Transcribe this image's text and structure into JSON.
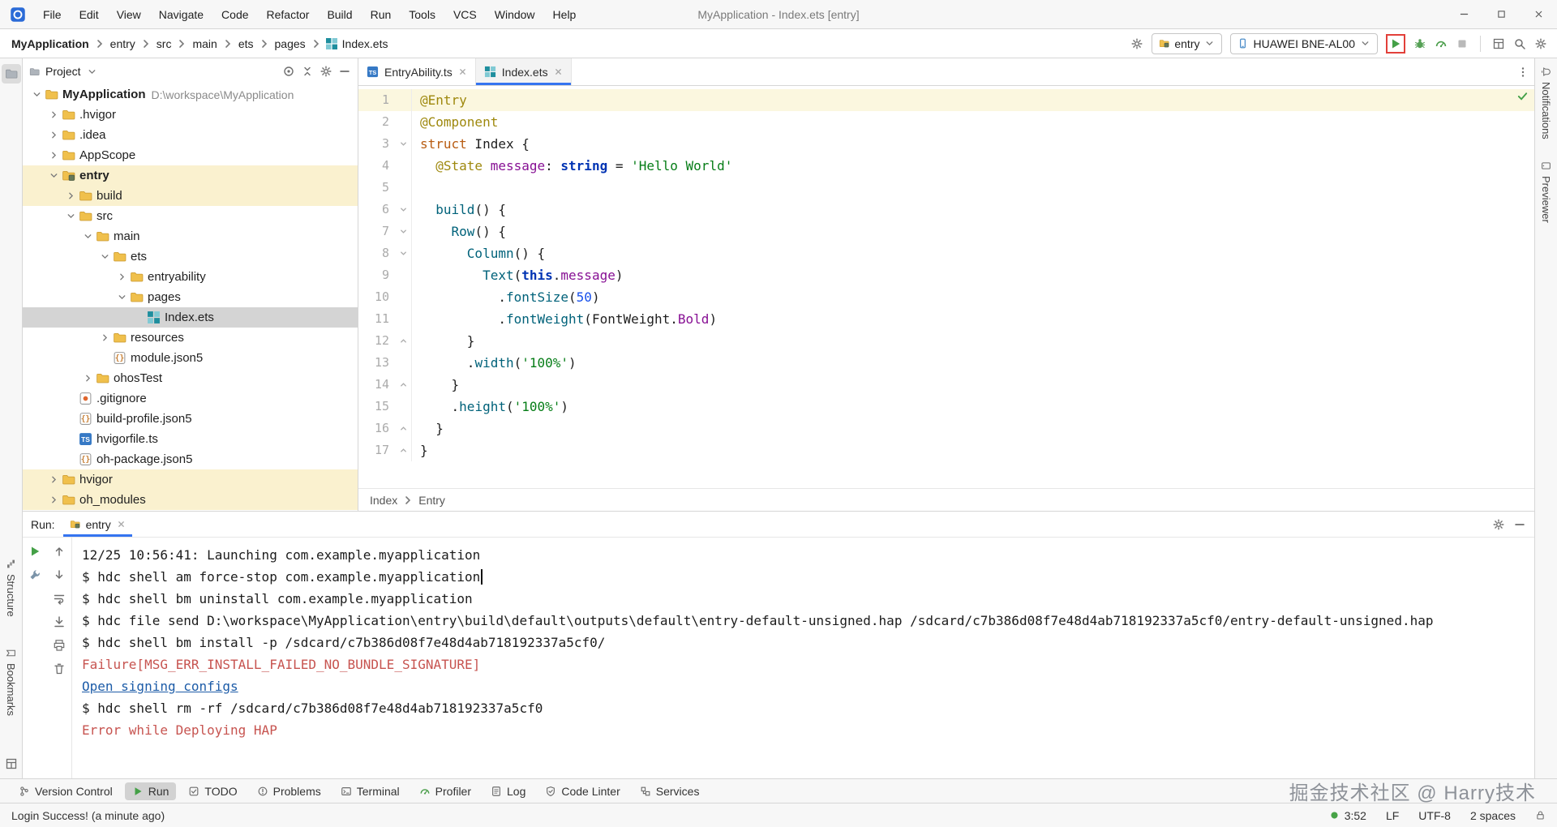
{
  "colors": {
    "accent": "#3574F0",
    "selection": "#D4D4D4",
    "module_row": "#FAF1CF",
    "error": "#C75450",
    "link": "#1D5CA8",
    "run_green": "#44A047",
    "highlight_box": "#E2403A"
  },
  "title_bar": {
    "menus": [
      "File",
      "Edit",
      "View",
      "Navigate",
      "Code",
      "Refactor",
      "Build",
      "Run",
      "Tools",
      "VCS",
      "Window",
      "Help"
    ],
    "title": "MyApplication - Index.ets [entry]"
  },
  "toolbar": {
    "breadcrumbs": [
      "MyApplication",
      "entry",
      "src",
      "main",
      "ets",
      "pages",
      "Index.ets"
    ],
    "run_config": "entry",
    "device": "HUAWEI BNE-AL00"
  },
  "left_stripe": {
    "project": "Project",
    "structure": "Structure",
    "bookmarks": "Bookmarks"
  },
  "right_stripe": {
    "notifications": "Notifications",
    "previewer": "Previewer"
  },
  "project_panel": {
    "header": "Project",
    "tree": [
      {
        "level": 0,
        "arrow": "down",
        "icon": "folder",
        "label": "MyApplication",
        "extra": "D:\\workspace\\MyApplication",
        "bold": true
      },
      {
        "level": 1,
        "arrow": "right",
        "icon": "folder",
        "label": ".hvigor"
      },
      {
        "level": 1,
        "arrow": "right",
        "icon": "folder",
        "label": ".idea"
      },
      {
        "level": 1,
        "arrow": "right",
        "icon": "folder",
        "label": "AppScope"
      },
      {
        "level": 1,
        "arrow": "down",
        "icon": "module",
        "label": "entry",
        "bg": "yellow",
        "bold": true
      },
      {
        "level": 2,
        "arrow": "right",
        "icon": "folder",
        "label": "build",
        "bg": "yellow"
      },
      {
        "level": 2,
        "arrow": "down",
        "icon": "folder",
        "label": "src"
      },
      {
        "level": 3,
        "arrow": "down",
        "icon": "folder",
        "label": "main"
      },
      {
        "level": 4,
        "arrow": "down",
        "icon": "folder",
        "label": "ets"
      },
      {
        "level": 5,
        "arrow": "right",
        "icon": "folder",
        "label": "entryability"
      },
      {
        "level": 5,
        "arrow": "down",
        "icon": "folder",
        "label": "pages"
      },
      {
        "level": 6,
        "arrow": "none",
        "icon": "fileEts",
        "label": "Index.ets",
        "selected": true
      },
      {
        "level": 4,
        "arrow": "right",
        "icon": "folder",
        "label": "resources"
      },
      {
        "level": 4,
        "arrow": "none",
        "icon": "fileJson",
        "label": "module.json5"
      },
      {
        "level": 3,
        "arrow": "right",
        "icon": "folder",
        "label": "ohosTest"
      },
      {
        "level": 2,
        "arrow": "none",
        "icon": "fileGit",
        "label": ".gitignore"
      },
      {
        "level": 2,
        "arrow": "none",
        "icon": "fileJson",
        "label": "build-profile.json5"
      },
      {
        "level": 2,
        "arrow": "none",
        "icon": "fileTs",
        "label": "hvigorfile.ts"
      },
      {
        "level": 2,
        "arrow": "none",
        "icon": "fileJson",
        "label": "oh-package.json5"
      },
      {
        "level": 1,
        "arrow": "right",
        "icon": "folder",
        "label": "hvigor",
        "bg": "yellow"
      },
      {
        "level": 1,
        "arrow": "right",
        "icon": "folder",
        "label": "oh_modules",
        "bg": "yellow"
      }
    ]
  },
  "editor": {
    "tabs": [
      {
        "label": "EntryAbility.ts",
        "icon": "fileTs",
        "active": false
      },
      {
        "label": "Index.ets",
        "icon": "fileEts",
        "active": true
      }
    ],
    "breadcrumb": [
      "Index",
      "Entry"
    ],
    "code_lines": [
      {
        "n": 1,
        "hl": true,
        "fold": "",
        "tokens": [
          {
            "c": "ann",
            "t": "@Entry"
          }
        ]
      },
      {
        "n": 2,
        "fold": "",
        "tokens": [
          {
            "c": "ann",
            "t": "@Component"
          }
        ]
      },
      {
        "n": 3,
        "fold": "open",
        "tokens": [
          {
            "c": "kw",
            "t": "struct"
          },
          {
            "c": "pl",
            "t": " Index {"
          }
        ]
      },
      {
        "n": 4,
        "fold": "",
        "tokens": [
          {
            "c": "pl",
            "t": "  "
          },
          {
            "c": "ann",
            "t": "@State"
          },
          {
            "c": "pl",
            "t": " "
          },
          {
            "c": "fld",
            "t": "message"
          },
          {
            "c": "pl",
            "t": ": "
          },
          {
            "c": "kwb",
            "t": "string"
          },
          {
            "c": "pl",
            "t": " = "
          },
          {
            "c": "str",
            "t": "'Hello World'"
          }
        ]
      },
      {
        "n": 5,
        "fold": "",
        "tokens": []
      },
      {
        "n": 6,
        "fold": "open",
        "tokens": [
          {
            "c": "pl",
            "t": "  "
          },
          {
            "c": "fn",
            "t": "build"
          },
          {
            "c": "pl",
            "t": "() {"
          }
        ]
      },
      {
        "n": 7,
        "fold": "open",
        "tokens": [
          {
            "c": "pl",
            "t": "    "
          },
          {
            "c": "fn",
            "t": "Row"
          },
          {
            "c": "pl",
            "t": "() {"
          }
        ]
      },
      {
        "n": 8,
        "fold": "open",
        "tokens": [
          {
            "c": "pl",
            "t": "      "
          },
          {
            "c": "fn",
            "t": "Column"
          },
          {
            "c": "pl",
            "t": "() {"
          }
        ]
      },
      {
        "n": 9,
        "fold": "",
        "tokens": [
          {
            "c": "pl",
            "t": "        "
          },
          {
            "c": "fn",
            "t": "Text"
          },
          {
            "c": "pl",
            "t": "("
          },
          {
            "c": "kwb",
            "t": "this"
          },
          {
            "c": "pl",
            "t": "."
          },
          {
            "c": "fld",
            "t": "message"
          },
          {
            "c": "pl",
            "t": ")"
          }
        ]
      },
      {
        "n": 10,
        "fold": "",
        "tokens": [
          {
            "c": "pl",
            "t": "          ."
          },
          {
            "c": "fn",
            "t": "fontSize"
          },
          {
            "c": "pl",
            "t": "("
          },
          {
            "c": "num",
            "t": "50"
          },
          {
            "c": "pl",
            "t": ")"
          }
        ]
      },
      {
        "n": 11,
        "fold": "",
        "tokens": [
          {
            "c": "pl",
            "t": "          ."
          },
          {
            "c": "fn",
            "t": "fontWeight"
          },
          {
            "c": "pl",
            "t": "("
          },
          {
            "c": "cls",
            "t": "FontWeight"
          },
          {
            "c": "pl",
            "t": "."
          },
          {
            "c": "fld",
            "t": "Bold"
          },
          {
            "c": "pl",
            "t": ")"
          }
        ]
      },
      {
        "n": 12,
        "fold": "close",
        "tokens": [
          {
            "c": "pl",
            "t": "      }"
          }
        ]
      },
      {
        "n": 13,
        "fold": "",
        "tokens": [
          {
            "c": "pl",
            "t": "      ."
          },
          {
            "c": "fn",
            "t": "width"
          },
          {
            "c": "pl",
            "t": "("
          },
          {
            "c": "str",
            "t": "'100%'"
          },
          {
            "c": "pl",
            "t": ")"
          }
        ]
      },
      {
        "n": 14,
        "fold": "close",
        "tokens": [
          {
            "c": "pl",
            "t": "    }"
          }
        ]
      },
      {
        "n": 15,
        "fold": "",
        "tokens": [
          {
            "c": "pl",
            "t": "    ."
          },
          {
            "c": "fn",
            "t": "height"
          },
          {
            "c": "pl",
            "t": "("
          },
          {
            "c": "str",
            "t": "'100%'"
          },
          {
            "c": "pl",
            "t": ")"
          }
        ]
      },
      {
        "n": 16,
        "fold": "close",
        "tokens": [
          {
            "c": "pl",
            "t": "  }"
          }
        ]
      },
      {
        "n": 17,
        "fold": "close",
        "tokens": [
          {
            "c": "pl",
            "t": "}"
          }
        ]
      }
    ]
  },
  "run_panel": {
    "label": "Run:",
    "tab": "entry",
    "console": [
      {
        "type": "normal",
        "text": "12/25 10:56:41: Launching com.example.myapplication"
      },
      {
        "type": "normal",
        "caret": true,
        "text": "$ hdc shell am force-stop com.example.myapplication"
      },
      {
        "type": "normal",
        "text": "$ hdc shell bm uninstall com.example.myapplication"
      },
      {
        "type": "normal",
        "text": "$ hdc file send D:\\workspace\\MyApplication\\entry\\build\\default\\outputs\\default\\entry-default-unsigned.hap /sdcard/c7b386d08f7e48d4ab718192337a5cf0/entry-default-unsigned.hap"
      },
      {
        "type": "normal",
        "text": "$ hdc shell bm install -p /sdcard/c7b386d08f7e48d4ab718192337a5cf0/"
      },
      {
        "type": "error",
        "text": "Failure[MSG_ERR_INSTALL_FAILED_NO_BUNDLE_SIGNATURE]"
      },
      {
        "type": "link",
        "text": "Open signing configs"
      },
      {
        "type": "normal",
        "text": "$ hdc shell rm -rf /sdcard/c7b386d08f7e48d4ab718192337a5cf0"
      },
      {
        "type": "error",
        "text": "Error while Deploying HAP"
      }
    ]
  },
  "bottom_bar": {
    "items": [
      {
        "label": "Version Control",
        "icon": "branch"
      },
      {
        "label": "Run",
        "icon": "play",
        "active": true
      },
      {
        "label": "TODO",
        "icon": "todo"
      },
      {
        "label": "Problems",
        "icon": "problems"
      },
      {
        "label": "Terminal",
        "icon": "terminal"
      },
      {
        "label": "Profiler",
        "icon": "gauge"
      },
      {
        "label": "Log",
        "icon": "log"
      },
      {
        "label": "Code Linter",
        "icon": "linter"
      },
      {
        "label": "Services",
        "icon": "services"
      }
    ],
    "watermark": "掘金技术社区 @ Harry技术"
  },
  "status_bar": {
    "message": "Login Success! (a minute ago)",
    "memory": "3:52",
    "line_ending": "LF",
    "encoding": "UTF-8",
    "indent": "2 spaces"
  }
}
